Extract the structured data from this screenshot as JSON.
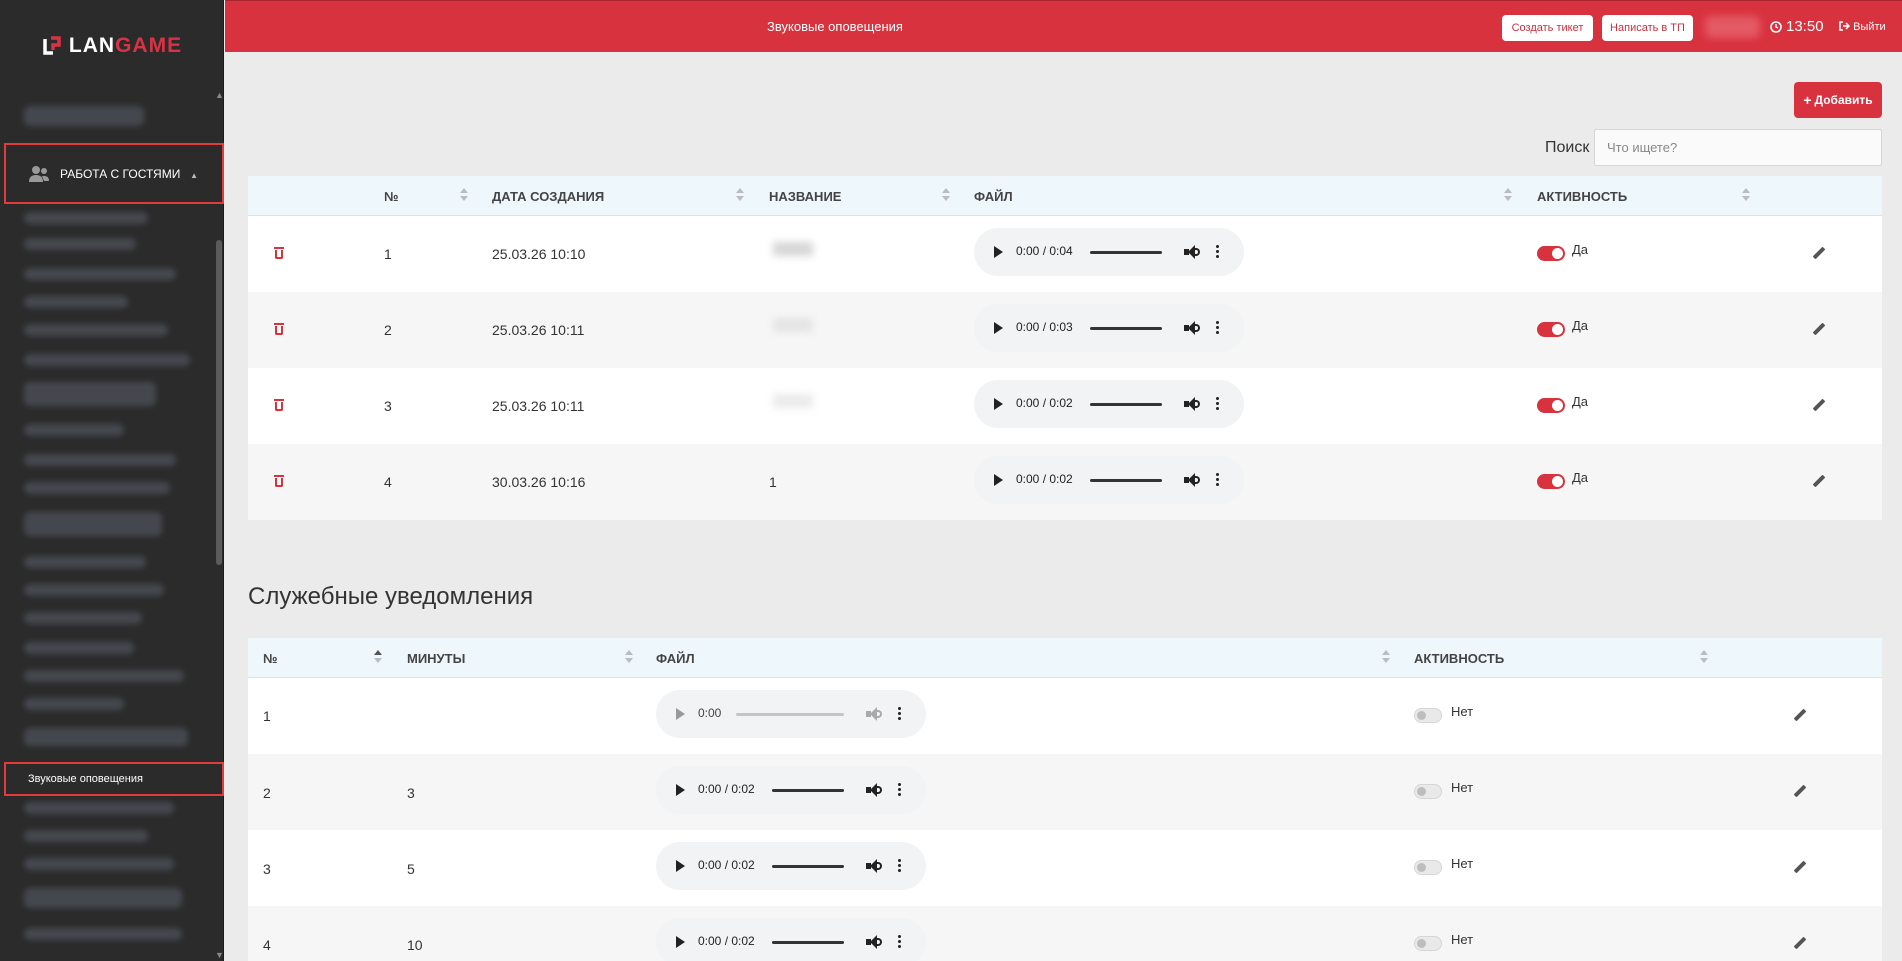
{
  "sidebar": {
    "logo_a": "LAN",
    "logo_b": "GAME",
    "active_group": "РАБОТА С ГОСТЯМИ",
    "active_item": "Звуковые оповещения"
  },
  "topbar": {
    "title": "Звуковые оповещения",
    "create_ticket": "Создать тикет",
    "write_support": "Написать в ТП",
    "time": "13:50",
    "logout": "Выйти"
  },
  "toolbar": {
    "add_label": "Добавить",
    "search_label": "Поиск",
    "search_placeholder": "Что ищете?"
  },
  "sounds": {
    "headers": [
      "№",
      "ДАТА СОЗДАНИЯ",
      "НАЗВАНИЕ",
      "ФАЙЛ",
      "АКТИВНОСТЬ"
    ],
    "rows": [
      {
        "num": "1",
        "date": "25.03.26 10:10",
        "name": "",
        "time": "0:00 / 0:04",
        "active": "Да"
      },
      {
        "num": "2",
        "date": "25.03.26 10:11",
        "name": "",
        "time": "0:00 / 0:03",
        "active": "Да"
      },
      {
        "num": "3",
        "date": "25.03.26 10:11",
        "name": "",
        "time": "0:00 / 0:02",
        "active": "Да"
      },
      {
        "num": "4",
        "date": "30.03.26 10:16",
        "name": "1",
        "time": "0:00 / 0:02",
        "active": "Да"
      }
    ]
  },
  "service": {
    "title": "Служебные уведомления",
    "headers": [
      "№",
      "МИНУТЫ",
      "ФАЙЛ",
      "АКТИВНОСТЬ"
    ],
    "rows": [
      {
        "num": "1",
        "minutes": "",
        "time": "0:00",
        "active": "Нет"
      },
      {
        "num": "2",
        "minutes": "3",
        "time": "0:00 / 0:02",
        "active": "Нет"
      },
      {
        "num": "3",
        "minutes": "5",
        "time": "0:00 / 0:02",
        "active": "Нет"
      },
      {
        "num": "4",
        "minutes": "10",
        "time": "0:00 / 0:02",
        "active": "Нет"
      }
    ]
  },
  "colors": {
    "accent": "#d8323f",
    "sidebar_bg": "#2b2b2b",
    "header_bg": "#eef7fc"
  }
}
